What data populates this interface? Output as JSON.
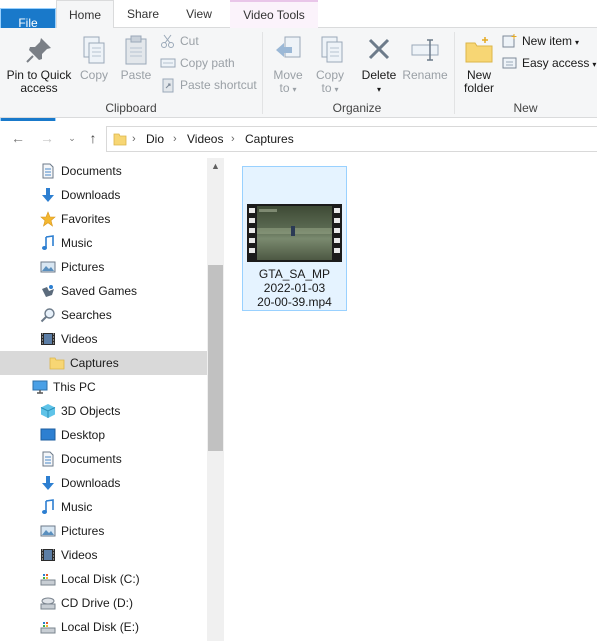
{
  "tabs": [
    "File",
    "Home",
    "Share",
    "View",
    "Video Tools"
  ],
  "ribbon": {
    "clipboard": {
      "label": "Clipboard",
      "pin": [
        "Pin to Quick",
        "access"
      ],
      "copy": "Copy",
      "paste": "Paste",
      "cut": "Cut",
      "copy_path": "Copy path",
      "paste_shortcut": "Paste shortcut"
    },
    "organize": {
      "label": "Organize",
      "move_to": [
        "Move",
        "to"
      ],
      "copy_to": [
        "Copy",
        "to"
      ],
      "delete": "Delete",
      "rename": "Rename"
    },
    "new": {
      "label": "New",
      "new_folder": [
        "New",
        "folder"
      ],
      "new_item": "New item",
      "easy_access": "Easy access"
    }
  },
  "address": {
    "crumbs": [
      "Dio",
      "Videos",
      "Captures"
    ]
  },
  "sidebar": {
    "items": [
      {
        "label": "Documents",
        "icon": "documents-icon"
      },
      {
        "label": "Downloads",
        "icon": "downloads-icon"
      },
      {
        "label": "Favorites",
        "icon": "favorites-icon"
      },
      {
        "label": "Music",
        "icon": "music-icon"
      },
      {
        "label": "Pictures",
        "icon": "pictures-icon"
      },
      {
        "label": "Saved Games",
        "icon": "saved-games-icon"
      },
      {
        "label": "Searches",
        "icon": "searches-icon"
      },
      {
        "label": "Videos",
        "icon": "videos-icon"
      },
      {
        "label": "Captures",
        "icon": "folder-icon",
        "selected": true
      },
      {
        "label": "This PC",
        "icon": "this-pc-icon"
      },
      {
        "label": "3D Objects",
        "icon": "3d-objects-icon"
      },
      {
        "label": "Desktop",
        "icon": "desktop-icon"
      },
      {
        "label": "Documents",
        "icon": "documents-icon"
      },
      {
        "label": "Downloads",
        "icon": "downloads-icon"
      },
      {
        "label": "Music",
        "icon": "music-icon"
      },
      {
        "label": "Pictures",
        "icon": "pictures-icon"
      },
      {
        "label": "Videos",
        "icon": "videos-icon"
      },
      {
        "label": "Local Disk (C:)",
        "icon": "local-disk-icon"
      },
      {
        "label": "CD Drive (D:)",
        "icon": "cd-drive-icon"
      },
      {
        "label": "Local Disk (E:)",
        "icon": "local-disk-icon"
      }
    ]
  },
  "files": [
    {
      "name_lines": [
        "GTA_SA_MP",
        "2022-01-03",
        "20-00-39.mp4"
      ],
      "icon": "video-thumbnail"
    }
  ],
  "colors": {
    "file_tab": "#1979ca",
    "selection": "#e5f3ff",
    "selection_border": "#99d1ff",
    "video_tools_tab": "#fbf3fb"
  }
}
